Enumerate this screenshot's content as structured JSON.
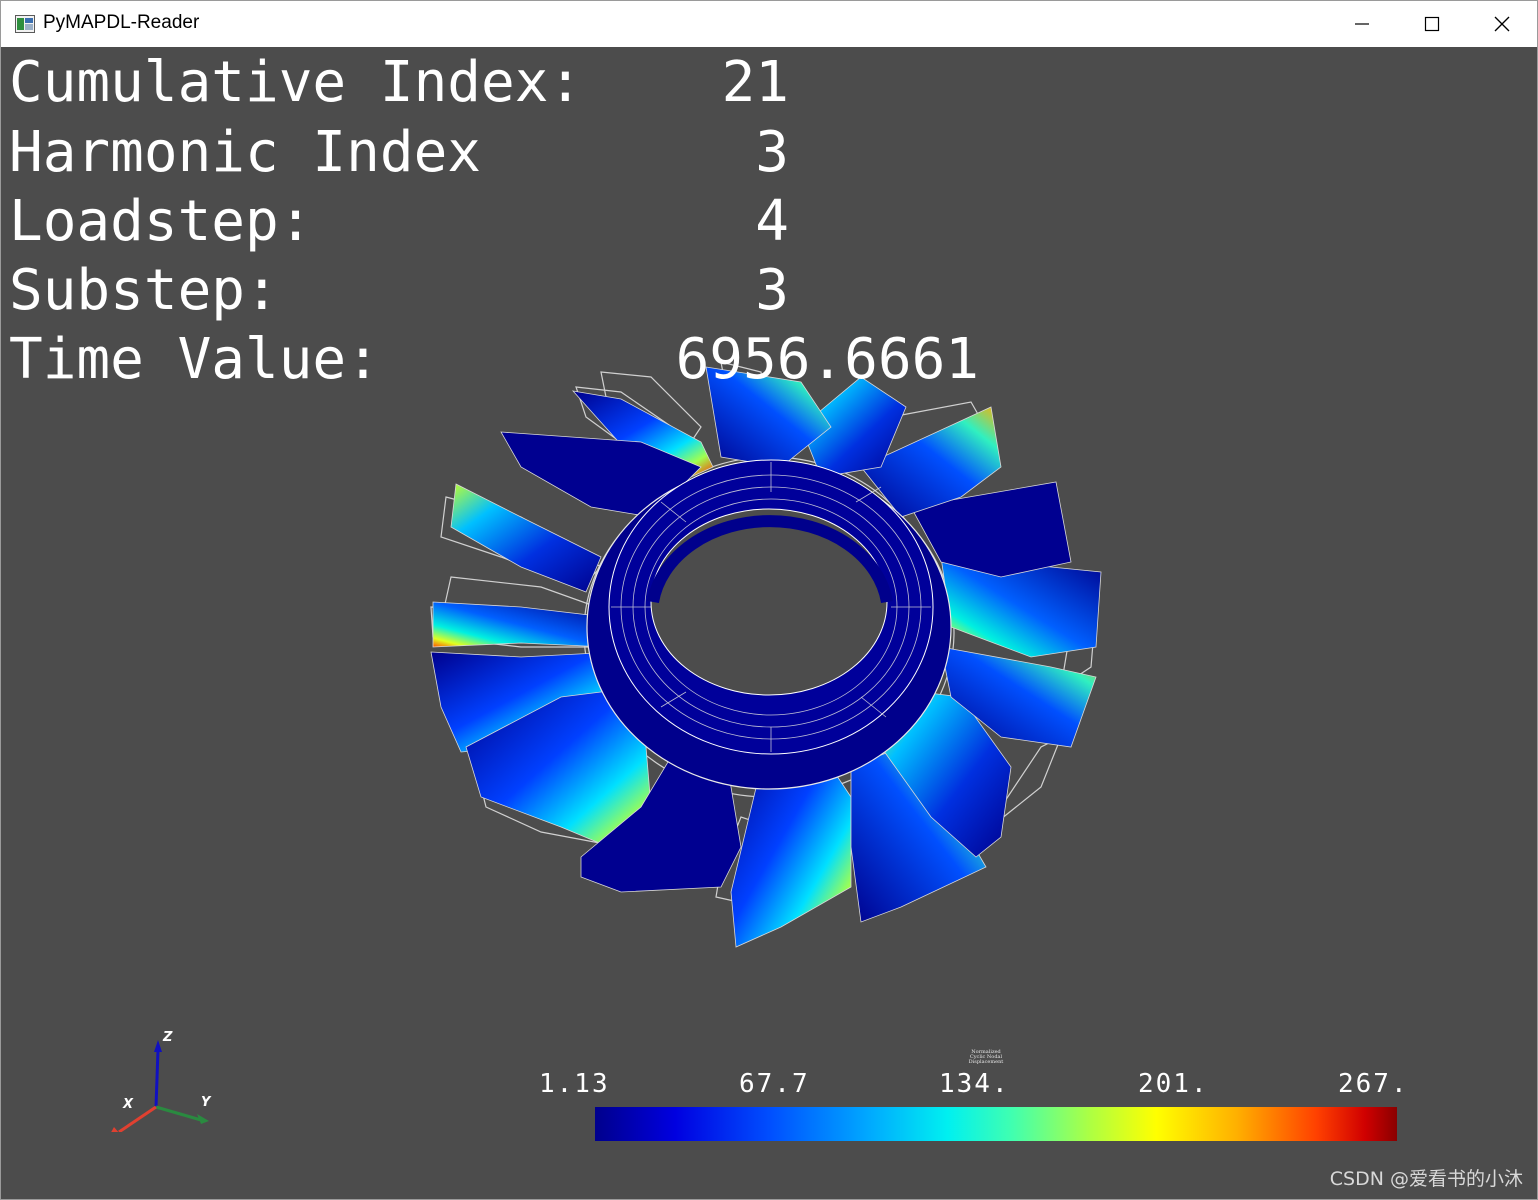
{
  "window": {
    "title": "PyMAPDL-Reader",
    "controls": {
      "minimize": "minimize",
      "maximize": "maximize",
      "close": "close"
    }
  },
  "info": {
    "cumulative_index_label": "Cumulative Index:",
    "cumulative_index_value": "21",
    "harmonic_index_label": "Harmonic Index",
    "harmonic_index_value": "3",
    "loadstep_label": "Loadstep:",
    "loadstep_value": "4",
    "substep_label": "Substep:",
    "substep_value": "3",
    "time_value_label": "Time Value:",
    "time_value_value": "6956.6661"
  },
  "colorbar": {
    "title_lines": [
      "Normalized",
      "Cyclic Nodal",
      "Displacement"
    ],
    "ticks": [
      "1.13",
      "67.7",
      "134.",
      "201.",
      "267."
    ],
    "colors": [
      "#00008c",
      "#0000e0",
      "#0050ff",
      "#00a8ff",
      "#00f0f0",
      "#b0ff40",
      "#ffff00",
      "#ffb000",
      "#ff4000",
      "#8a0000"
    ]
  },
  "axes": {
    "z": "Z",
    "x": "X",
    "y": "Y"
  },
  "watermark": "CSDN @爱看书的小沐",
  "colors": {
    "background": "#4c4c4c",
    "mesh": "#ffffff",
    "base": "#00008c"
  }
}
